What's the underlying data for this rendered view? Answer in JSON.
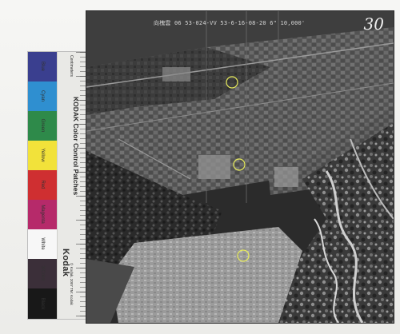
{
  "scan": {
    "background_color": "#f1f1ef"
  },
  "photo": {
    "header_text": "向槐雲 06 53-024-VV 53-6-16-08-20 6\" 10,000'",
    "frame_number": "30"
  },
  "color_strip": {
    "title": "KODAK Color Control Patches",
    "brand": "Kodak",
    "patches": [
      {
        "name": "Blue",
        "color": "#3a3f8f"
      },
      {
        "name": "Cyan",
        "color": "#2f8fd0"
      },
      {
        "name": "Green",
        "color": "#2e8a4a"
      },
      {
        "name": "Yellow",
        "color": "#f2e23a"
      },
      {
        "name": "Red",
        "color": "#cf2f31"
      },
      {
        "name": "Magenta",
        "color": "#b62a6a"
      },
      {
        "name": "White",
        "color": "#f7f7f7"
      },
      {
        "name": "3/Color",
        "color": "#3b2f39"
      },
      {
        "name": "Black",
        "color": "#181818"
      }
    ],
    "side_text": "Centimeters",
    "registration_text": "© Kodak, 2007 TM: Kodak"
  },
  "annotations": {
    "circle_color": "#e8ec5c"
  }
}
